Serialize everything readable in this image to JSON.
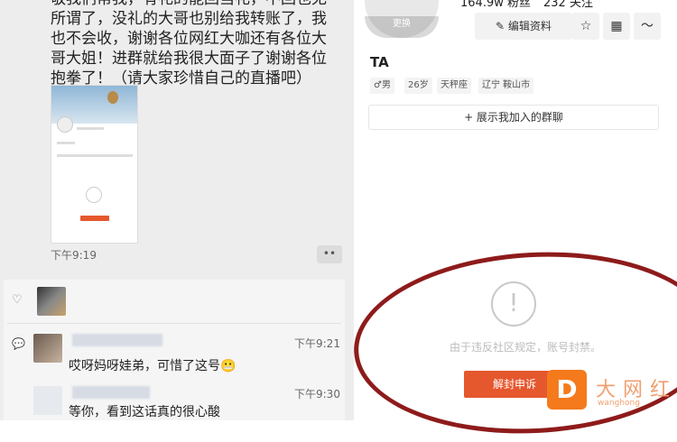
{
  "post": {
    "text": "敬我们帮我，有礼的能回当礼，不回也无所谓了，没礼的大哥也别给我转账了，我也不会收，谢谢各位网红大咖还有各位大哥大姐！进群就给我很大面子了谢谢各位抱拳了！（请大家珍惜自己的直播吧）",
    "time": "下午9:19",
    "more_label": "••"
  },
  "comments": [
    {
      "time": "下午9:21",
      "text": "哎呀妈呀娃弟，可惜了这号😬"
    },
    {
      "time": "下午9:30",
      "text": "等你，看到这话真的很心酸"
    }
  ],
  "profile": {
    "avatar_change_label": "更换",
    "fans": "164.9w 粉丝",
    "follows": "232 关注",
    "edit_label": "编辑资料",
    "username": "TA",
    "tags": [
      "♂男",
      "26岁",
      "天秤座",
      "辽宁 鞍山市"
    ],
    "groups_label": "+ 展示我加入的群聊",
    "ban_text": "由于违反社区规定，账号封禁。",
    "appeal_label": "解封申诉"
  },
  "watermark": {
    "letter": "D",
    "text": "大网红",
    "sub": "wanghong"
  },
  "colors": {
    "accent": "#e5572d",
    "annotation": "#8e1b1b"
  }
}
